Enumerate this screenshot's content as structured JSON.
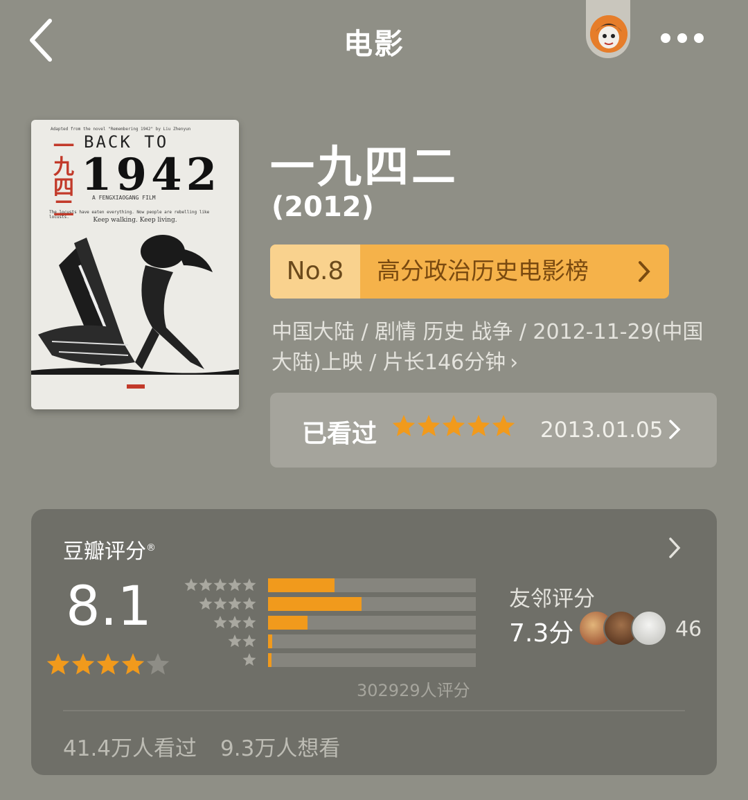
{
  "header": {
    "title": "电影",
    "back_icon": "chevron-left-icon",
    "more_icon": "more-dots-icon"
  },
  "poster": {
    "tagline_top": "Adapted from the novel \"Remembering 1942\" by Liu Zhenyun",
    "cn_title_vertical": "一九四二",
    "back_to": "BACK TO",
    "year": "1942",
    "film_by": "A FENGXIAOGANG FILM",
    "tagline_1": "The locusts have eaten everything. Now people are rebelling like locusts.",
    "tagline_2": "Keep walking. Keep living."
  },
  "movie": {
    "title": "一九四二",
    "year": "(2012)",
    "rank_no": "No.8",
    "rank_name": "高分政治历史电影榜",
    "meta": "中国大陆 / 剧情 历史 战争 / 2012-11-29(中国大陆)上映 / 片长146分钟",
    "meta_chevron": "›"
  },
  "watched": {
    "label": "已看过",
    "stars": 5,
    "date": "2013.01.05"
  },
  "rating": {
    "title": "豆瓣评分",
    "title_mark": "®",
    "score": "8.1",
    "score_stars": 4,
    "distribution": [
      {
        "stars": 5,
        "fraction": 0.32
      },
      {
        "stars": 4,
        "fraction": 0.45
      },
      {
        "stars": 3,
        "fraction": 0.19
      },
      {
        "stars": 2,
        "fraction": 0.02
      },
      {
        "stars": 1,
        "fraction": 0.015
      }
    ],
    "count": "302929人评分",
    "friends_title": "友邻评分",
    "friends_score": "7.3分",
    "friends_count": "46",
    "watched_count": "41.4万人看过",
    "wish_count": "9.3万人想看"
  },
  "colors": {
    "background": "#8f8f86",
    "accent": "#f19a1c",
    "rank_badge": "#f5b24a"
  }
}
